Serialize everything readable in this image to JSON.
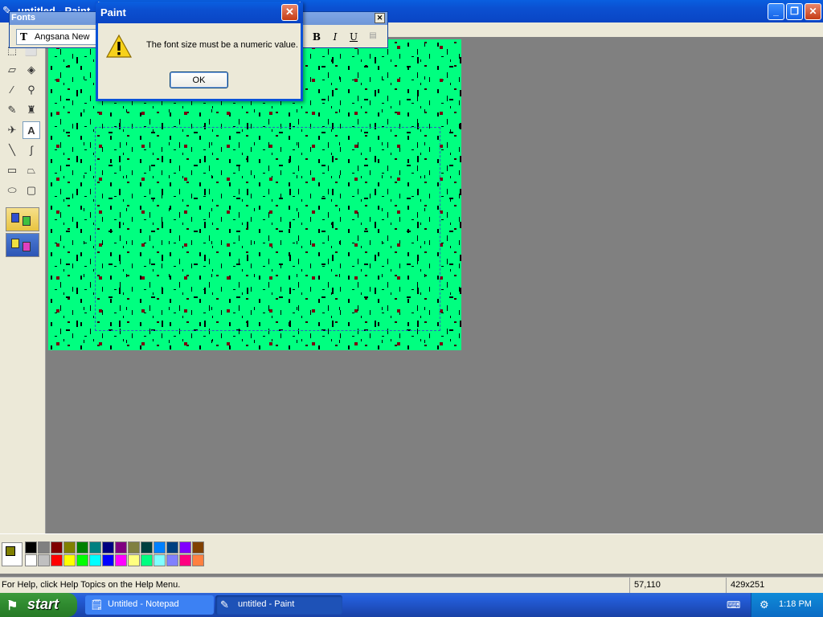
{
  "window": {
    "title": "untitled - Paint",
    "controls": [
      "minimize",
      "maximize",
      "close"
    ]
  },
  "fonts_toolbar": {
    "title": "Fonts",
    "font_name": "Angsana New",
    "bold_label": "B",
    "italic_label": "I",
    "underline_label": "U"
  },
  "dialog": {
    "title": "Paint",
    "message": "The font size must be a numeric value.",
    "ok_label": "OK",
    "icon": "warning-icon"
  },
  "toolbox": {
    "tools": [
      "free-form-select",
      "select",
      "eraser",
      "fill-with-color",
      "pick-color",
      "magnifier",
      "pencil",
      "brush",
      "airbrush",
      "text",
      "line",
      "curve",
      "rectangle",
      "polygon",
      "ellipse",
      "rounded-rectangle"
    ],
    "selected_tool": "text"
  },
  "palette": {
    "foreground": "#808000",
    "background": "#ffffff",
    "colors_row1": [
      "#000000",
      "#808080",
      "#800000",
      "#808000",
      "#008000",
      "#008080",
      "#000080",
      "#800080",
      "#808040",
      "#004040",
      "#0080ff",
      "#004080",
      "#8000ff",
      "#804000"
    ],
    "colors_row2": [
      "#ffffff",
      "#c0c0c0",
      "#ff0000",
      "#ffff00",
      "#00ff00",
      "#00ffff",
      "#0000ff",
      "#ff00ff",
      "#ffff80",
      "#00ff80",
      "#80ffff",
      "#8080ff",
      "#ff0080",
      "#ff8040"
    ]
  },
  "canvas": {
    "background": "#00ff80"
  },
  "statusbar": {
    "help": "For Help, click Help Topics on the Help Menu.",
    "coords": "57,110",
    "size": "429x251"
  },
  "taskbar": {
    "start_label": "start",
    "items": [
      {
        "label": "Untitled - Notepad",
        "active": false
      },
      {
        "label": "untitled - Paint",
        "active": true
      }
    ],
    "clock": "1:18 PM"
  }
}
